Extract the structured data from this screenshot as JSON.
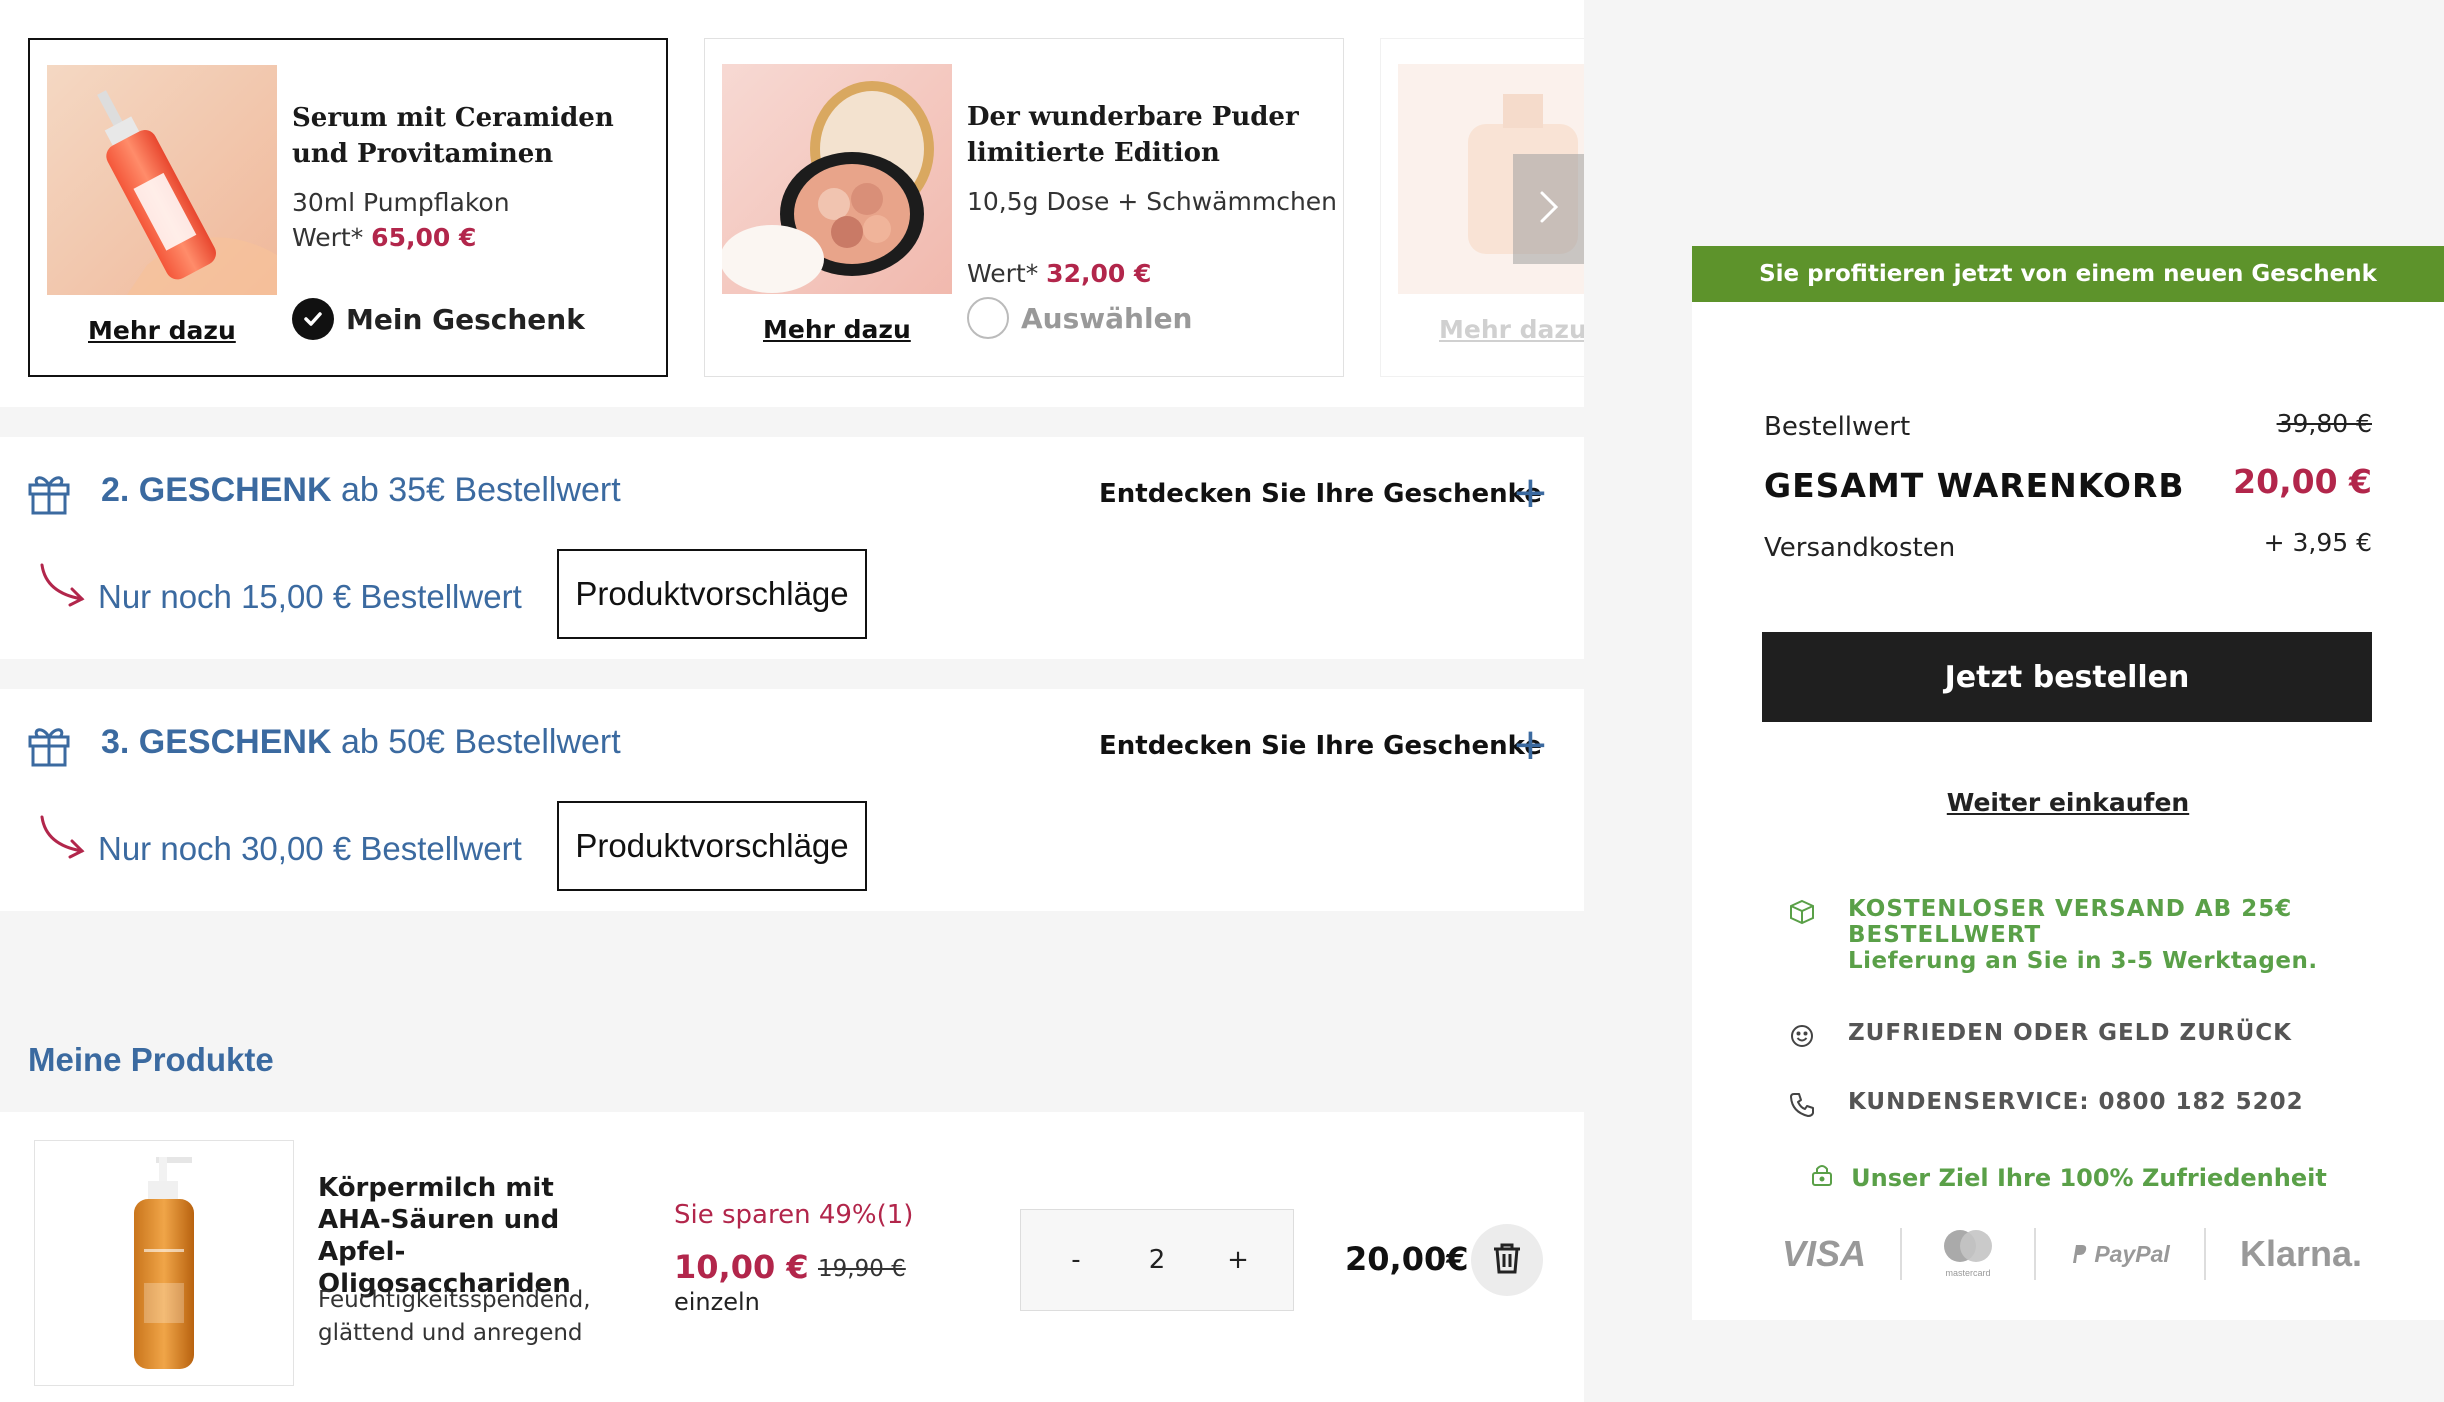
{
  "gift_carousel": {
    "cards": [
      {
        "title": "Serum mit Ceramiden und Provitaminen",
        "description": "30ml Pumpflakon",
        "value_label": "Wert*",
        "value_amount": "65,00 €",
        "more_label": "Mehr dazu",
        "choice_label": "Mein Geschenk",
        "selected": true
      },
      {
        "title": "Der wunderbare Puder limitierte Edition",
        "description": "10,5g Dose + Schwämmchen",
        "value_label": "Wert*",
        "value_amount": "32,00 €",
        "more_label": "Mehr dazu",
        "choice_label": "Auswählen",
        "selected": false
      },
      {
        "more_label": "Mehr dazu"
      }
    ]
  },
  "tiers": [
    {
      "number": "2. GESCHENK",
      "threshold": "ab 35€ Bestellwert",
      "discover_label": "Entdecken Sie Ihre Geschenke",
      "remaining": "Nur noch 15,00 € Bestellwert",
      "suggestions_label": "Produktvorschläge"
    },
    {
      "number": "3. GESCHENK",
      "threshold": "ab 50€ Bestellwert",
      "discover_label": "Entdecken Sie Ihre Geschenke",
      "remaining": "Nur noch 30,00 € Bestellwert",
      "suggestions_label": "Produktvorschläge"
    }
  ],
  "my_products": {
    "title": "Meine Produkte",
    "items": [
      {
        "name": "Körpermilch mit AHA-Säuren und Apfel-Oligosacchariden",
        "description": "Feuchtigkeitsspendend, glättend und anregend",
        "savings": "Sie sparen 49%(1)",
        "price": "10,00 €",
        "old_price": "19,90 €",
        "unit_label": "einzeln",
        "quantity": "2",
        "decrement_label": "-",
        "increment_label": "+",
        "total": "20,00€"
      }
    ]
  },
  "summary": {
    "gift_banner": "Sie profitieren jetzt von einem neuen Geschenk",
    "order_value_label": "Bestellwert",
    "order_value": "39,80 €",
    "cart_total_label": "GESAMT WARENKORB",
    "cart_total": "20,00 €",
    "shipping_label": "Versandkosten",
    "shipping_value": "+ 3,95 €",
    "order_button": "Jetzt bestellen",
    "continue_link": "Weiter einkaufen",
    "perks": {
      "free_shipping_line1": "KOSTENLOSER VERSAND AB 25€",
      "free_shipping_line2": "BESTELLWERT",
      "delivery": "Lieferung an Sie in 3-5 Werktagen.",
      "guarantee": "ZUFRIEDEN ODER GELD ZURÜCK",
      "service": "KUNDENSERVICE: 0800 182 5202"
    },
    "satisfaction": "Unser Ziel Ihre 100% Zufriedenheit",
    "payments": {
      "visa": "VISA",
      "mastercard": "mastercard",
      "paypal": "PayPal",
      "klarna": "Klarna."
    }
  },
  "colors": {
    "accent_blue": "#3b6aa0",
    "price_red": "#b2264b",
    "banner_green": "#5d932b",
    "perk_green": "#5aa048"
  }
}
